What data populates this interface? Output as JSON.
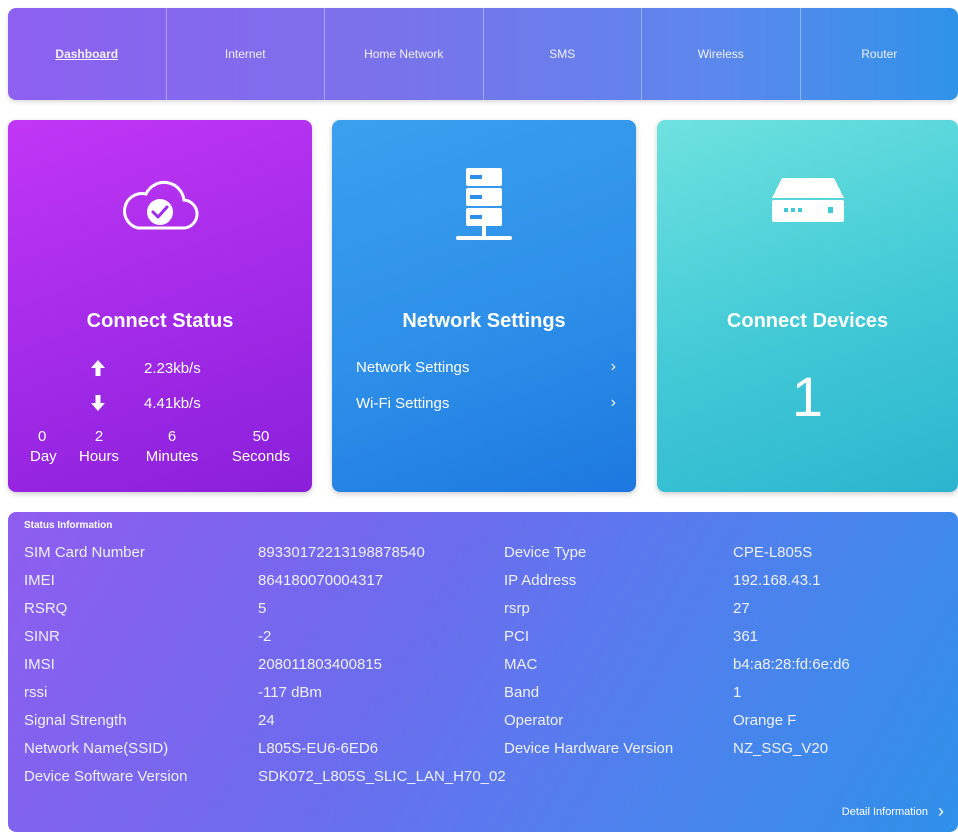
{
  "nav": {
    "items": [
      {
        "label": "Dashboard",
        "active": true
      },
      {
        "label": "Internet"
      },
      {
        "label": "Home Network"
      },
      {
        "label": "SMS"
      },
      {
        "label": "Wireless"
      },
      {
        "label": "Router"
      }
    ]
  },
  "connect_status": {
    "icon": "cloud-check-icon",
    "title": "Connect Status",
    "upload": "2.23kb/s",
    "download": "4.41kb/s",
    "timer": {
      "day": "0",
      "hours": "2",
      "minutes": "6",
      "seconds": "50",
      "day_label": "Day",
      "hours_label": "Hours",
      "minutes_label": "Minutes",
      "seconds_label": "Seconds"
    }
  },
  "network_settings": {
    "icon": "server-icon",
    "title": "Network Settings",
    "links": [
      "Network Settings",
      "Wi-Fi Settings"
    ]
  },
  "connect_devices": {
    "icon": "router-icon",
    "title": "Connect Devices",
    "count": "1"
  },
  "status_info": {
    "title": "Status Information",
    "rows": [
      [
        "SIM Card Number",
        "89330172213198878540",
        "Device Type",
        "CPE-L805S"
      ],
      [
        "IMEI",
        "864180070004317",
        "IP Address",
        "192.168.43.1"
      ],
      [
        "RSRQ",
        "5",
        "rsrp",
        "27"
      ],
      [
        "SINR",
        "-2",
        "PCI",
        "361"
      ],
      [
        "IMSI",
        "208011803400815",
        "MAC",
        "b4:a8:28:fd:6e:d6"
      ],
      [
        "rssi",
        "-117 dBm",
        "Band",
        "1"
      ],
      [
        "Signal Strength",
        "24",
        "Operator",
        "Orange F"
      ],
      [
        "Network Name(SSID)",
        "L805S-EU6-6ED6",
        "Device Hardware Version",
        "NZ_SSG_V20"
      ],
      [
        "Device Software Version",
        "SDK072_L805S_SLIC_LAN_H70_02",
        "",
        ""
      ]
    ],
    "detail_label": "Detail Information"
  },
  "colors": {
    "purple": "#a12ae8",
    "blue": "#2d8fe9",
    "teal": "#41c9d6",
    "nav": "#7a72ea"
  }
}
